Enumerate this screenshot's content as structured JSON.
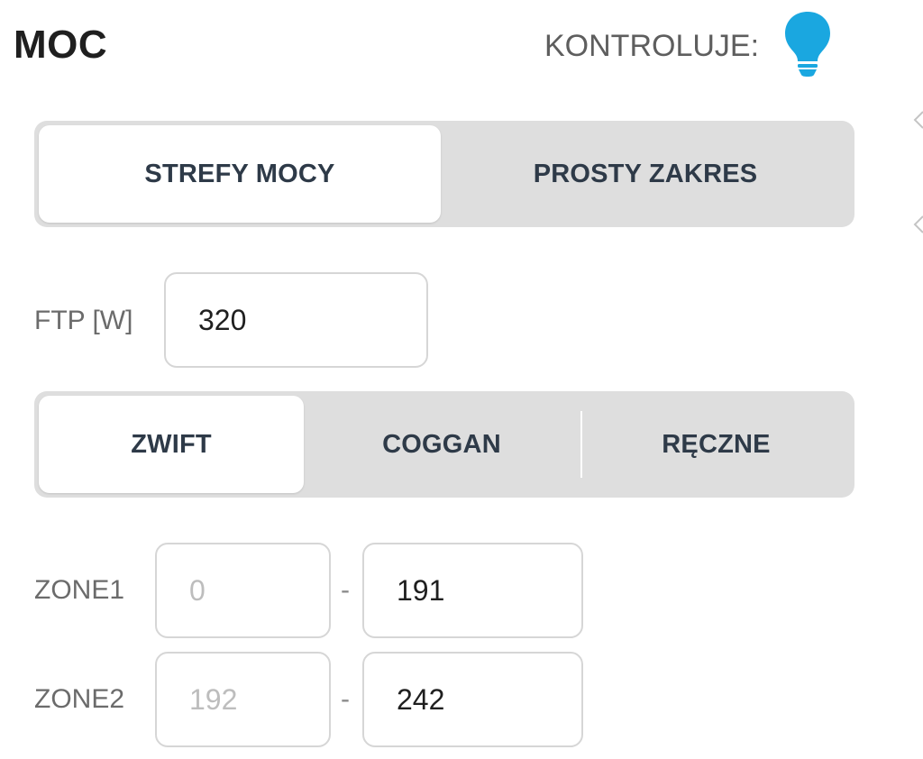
{
  "header": {
    "title": "MOC",
    "controls_label": "KONTROLUJE:",
    "controls_icon": "lightbulb-icon",
    "icon_color": "#1aa7e0"
  },
  "mode_switch": {
    "options": [
      "STREFY MOCY",
      "PROSTY ZAKRES"
    ],
    "selected": "STREFY MOCY"
  },
  "ftp": {
    "label": "FTP [W]",
    "value": "320"
  },
  "zone_model": {
    "options": [
      "ZWIFT",
      "COGGAN",
      "RĘCZNE"
    ],
    "selected": "ZWIFT"
  },
  "zones": [
    {
      "label": "ZONE1",
      "from": "0",
      "separator": "-",
      "to": "191"
    },
    {
      "label": "ZONE2",
      "from": "192",
      "separator": "-",
      "to": "242"
    }
  ]
}
